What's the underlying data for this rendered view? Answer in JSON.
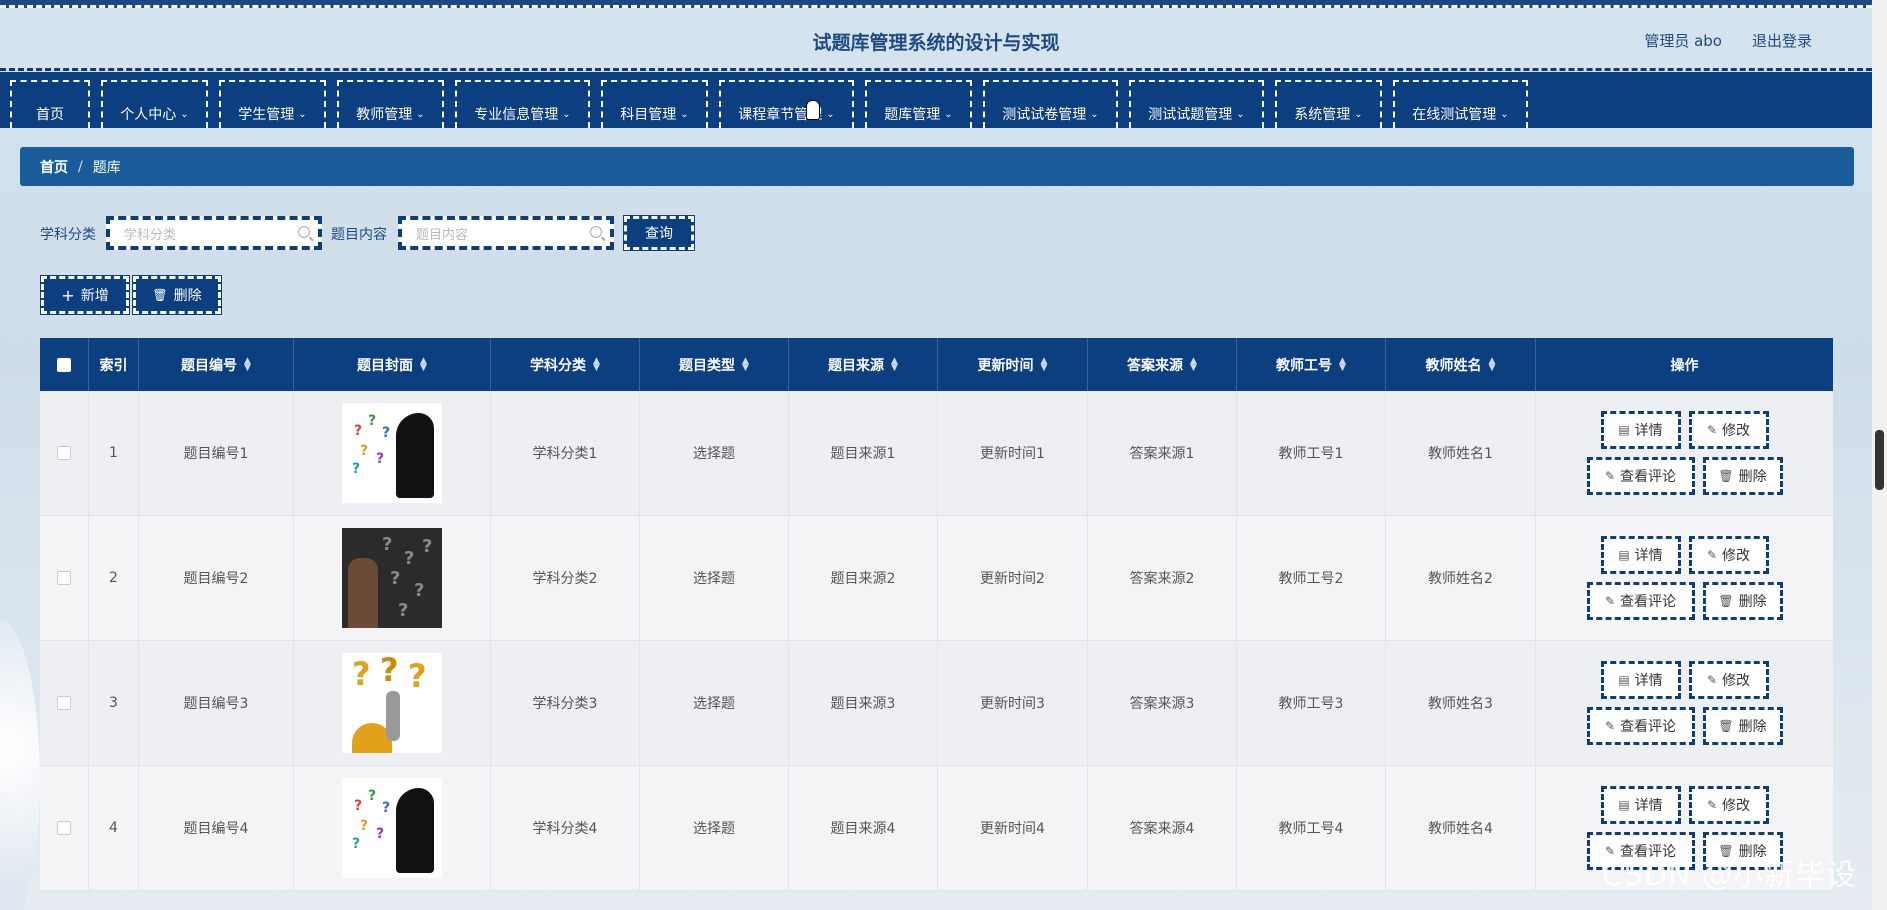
{
  "header": {
    "title": "试题库管理系统的设计与实现",
    "user": "管理员 abo",
    "logout": "退出登录"
  },
  "nav": [
    {
      "label": "首页",
      "has_menu": false
    },
    {
      "label": "个人中心",
      "has_menu": true
    },
    {
      "label": "学生管理",
      "has_menu": true
    },
    {
      "label": "教师管理",
      "has_menu": true
    },
    {
      "label": "专业信息管理",
      "has_menu": true
    },
    {
      "label": "科目管理",
      "has_menu": true
    },
    {
      "label": "课程章节管理",
      "has_menu": true
    },
    {
      "label": "题库管理",
      "has_menu": true
    },
    {
      "label": "测试试卷管理",
      "has_menu": true
    },
    {
      "label": "测试试题管理",
      "has_menu": true
    },
    {
      "label": "系统管理",
      "has_menu": true
    },
    {
      "label": "在线测试管理",
      "has_menu": true
    }
  ],
  "breadcrumb": {
    "home": "首页",
    "separator": "/",
    "current": "题库"
  },
  "filters": {
    "subject_label": "学科分类",
    "subject_placeholder": "学科分类",
    "content_label": "题目内容",
    "content_placeholder": "题目内容",
    "query_button": "查询"
  },
  "actions": {
    "add": "新增",
    "delete": "删除"
  },
  "table": {
    "headers": [
      "索引",
      "题目编号",
      "题目封面",
      "学科分类",
      "题目类型",
      "题目来源",
      "更新时间",
      "答案来源",
      "教师工号",
      "教师姓名",
      "操作"
    ],
    "rows": [
      {
        "index": "1",
        "code": "题目编号1",
        "subject": "学科分类1",
        "type": "选择题",
        "source": "题目来源1",
        "updated": "更新时间1",
        "answer_source": "答案来源1",
        "teacher_id": "教师工号1",
        "teacher_name": "教师姓名1",
        "cover": "thinking-head"
      },
      {
        "index": "2",
        "code": "题目编号2",
        "subject": "学科分类2",
        "type": "选择题",
        "source": "题目来源2",
        "updated": "更新时间2",
        "answer_source": "答案来源2",
        "teacher_id": "教师工号2",
        "teacher_name": "教师姓名2",
        "cover": "man-question-marks"
      },
      {
        "index": "3",
        "code": "题目编号3",
        "subject": "学科分类3",
        "type": "选择题",
        "source": "题目来源3",
        "updated": "更新时间3",
        "answer_source": "答案来源3",
        "teacher_id": "教师工号3",
        "teacher_name": "教师姓名3",
        "cover": "golden-question-marks"
      },
      {
        "index": "4",
        "code": "题目编号4",
        "subject": "学科分类4",
        "type": "选择题",
        "source": "题目来源4",
        "updated": "更新时间4",
        "answer_source": "答案来源4",
        "teacher_id": "教师工号4",
        "teacher_name": "教师姓名4",
        "cover": "thinking-head"
      }
    ],
    "ops": {
      "detail": "详情",
      "edit": "修改",
      "comments": "查看评论",
      "delete": "删除"
    }
  },
  "watermark": "CSDN @小新毕设",
  "colors": {
    "primary": "#0b3f80",
    "breadcrumb": "#1a5c9a",
    "title": "#1f4b80"
  }
}
